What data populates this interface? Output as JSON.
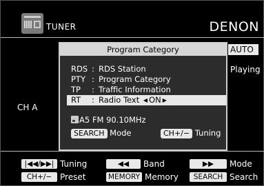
{
  "header": {
    "source": "TUNER",
    "brand": "DENON",
    "source_icon": "radio-icon"
  },
  "background": {
    "auto_badge": "AUTO",
    "playing": "Playing",
    "channel": "CH A"
  },
  "popup": {
    "title": "Program Category",
    "rows": [
      {
        "code": "RDS",
        "sep": ":",
        "label": "RDS Station"
      },
      {
        "code": "PTY",
        "sep": ":",
        "label": "Program Category"
      },
      {
        "code": "TP",
        "sep": ":",
        "label": "Traffic Information"
      },
      {
        "code": "RT",
        "sep": ":",
        "label": "Radio Text",
        "value": "ON",
        "left_arrow": "◀",
        "right_arrow": "▶"
      }
    ],
    "station": "A5 FM 90.10MHz",
    "station_icon": "preset-icon",
    "search_key": "SEARCH",
    "search_action": "Mode",
    "tuning_key": "CH+/−",
    "tuning_action": "Tuning"
  },
  "footer": {
    "tuning": {
      "key": "|◀◀/▶▶|",
      "label": "Tuning"
    },
    "band": {
      "key": "◀◀",
      "label": "Band"
    },
    "mode": {
      "key": "▶▶",
      "label": "Mode"
    },
    "preset": {
      "key": "CH+/−",
      "label": "Preset"
    },
    "memory": {
      "key": "MEMORY",
      "label": "Memory"
    },
    "search": {
      "key": "SEARCH",
      "label": "Search"
    }
  }
}
